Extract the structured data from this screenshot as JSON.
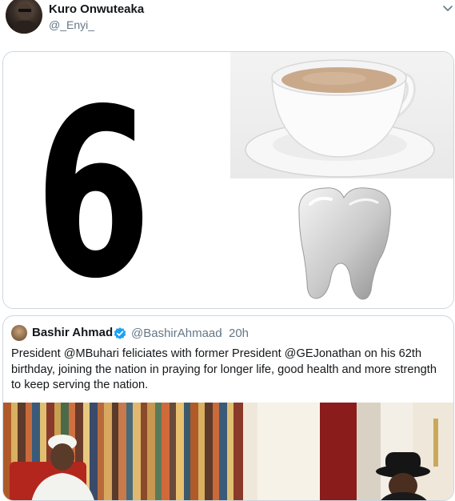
{
  "tweet": {
    "author_name": "Kuro Onwuteaka",
    "author_handle": "@_Enyi_",
    "menu_icon": "chevron-down-icon",
    "media": {
      "number_text": "6",
      "images": [
        "tea-cup-image",
        "tooth-image"
      ]
    }
  },
  "quoted_tweet": {
    "author_name": "Bashir Ahmad",
    "verified_icon": "verified-badge-icon",
    "author_handle": "@BashirAhmaad",
    "separator": "·",
    "time": "20h",
    "text": "President @MBuhari feliciates with former President @GEJonathan on his 62th birthday, joining the nation in praying for longer life, good health and more strength to keep serving the nation.",
    "photo": "presidents-meeting-photo"
  },
  "colors": {
    "text_primary": "#14171a",
    "text_secondary": "#657786",
    "border": "#ccd6dd",
    "verified": "#1da1f2"
  }
}
